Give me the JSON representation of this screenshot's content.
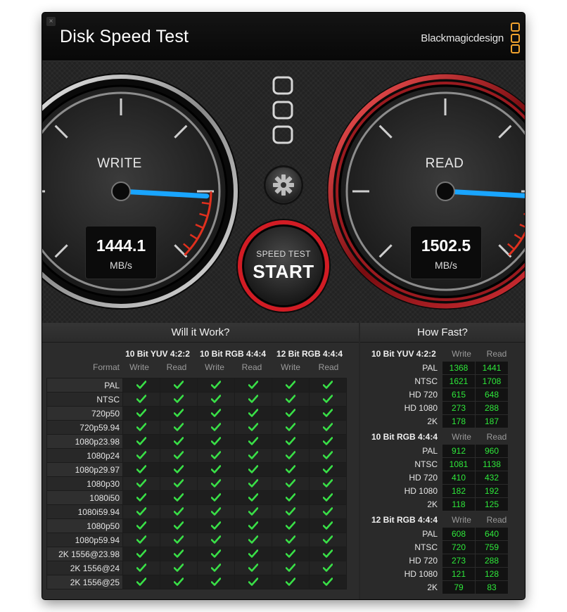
{
  "window": {
    "title": "Disk Speed Test",
    "brand": "Blackmagicdesign",
    "close_label": "×"
  },
  "gauges": {
    "write": {
      "label": "WRITE",
      "value": "1444.1",
      "unit": "MB/s",
      "needle_fraction": 0.845
    },
    "read": {
      "label": "READ",
      "value": "1502.5",
      "unit": "MB/s",
      "needle_fraction": 0.845
    }
  },
  "icons": {
    "settings": "gear-icon",
    "logo": "blackmagic-logo-icon",
    "check": "check-icon"
  },
  "start_button": {
    "small_label": "SPEED TEST",
    "big_label": "START"
  },
  "colors": {
    "accent_orange": "#f0a22e",
    "needle_blue": "#19a5ff",
    "ok_green": "#2ee83a",
    "read_ring_red": "#c0141c"
  },
  "will_it_work": {
    "title": "Will it Work?",
    "format_label": "Format",
    "write_label": "Write",
    "read_label": "Read",
    "groups": [
      "10 Bit YUV 4:2:2",
      "10 Bit RGB 4:4:4",
      "12 Bit RGB 4:4:4"
    ],
    "formats": [
      "PAL",
      "NTSC",
      "720p50",
      "720p59.94",
      "1080p23.98",
      "1080p24",
      "1080p29.97",
      "1080p30",
      "1080i50",
      "1080i59.94",
      "1080p50",
      "1080p59.94",
      "2K 1556@23.98",
      "2K 1556@24",
      "2K 1556@25"
    ]
  },
  "how_fast": {
    "title": "How Fast?",
    "write_label": "Write",
    "read_label": "Read",
    "groups": [
      {
        "name": "10 Bit YUV 4:2:2",
        "rows": [
          {
            "format": "PAL",
            "write": "1368",
            "read": "1441"
          },
          {
            "format": "NTSC",
            "write": "1621",
            "read": "1708"
          },
          {
            "format": "HD 720",
            "write": "615",
            "read": "648"
          },
          {
            "format": "HD 1080",
            "write": "273",
            "read": "288"
          },
          {
            "format": "2K",
            "write": "178",
            "read": "187"
          }
        ]
      },
      {
        "name": "10 Bit RGB 4:4:4",
        "rows": [
          {
            "format": "PAL",
            "write": "912",
            "read": "960"
          },
          {
            "format": "NTSC",
            "write": "1081",
            "read": "1138"
          },
          {
            "format": "HD 720",
            "write": "410",
            "read": "432"
          },
          {
            "format": "HD 1080",
            "write": "182",
            "read": "192"
          },
          {
            "format": "2K",
            "write": "118",
            "read": "125"
          }
        ]
      },
      {
        "name": "12 Bit RGB 4:4:4",
        "rows": [
          {
            "format": "PAL",
            "write": "608",
            "read": "640"
          },
          {
            "format": "NTSC",
            "write": "720",
            "read": "759"
          },
          {
            "format": "HD 720",
            "write": "273",
            "read": "288"
          },
          {
            "format": "HD 1080",
            "write": "121",
            "read": "128"
          },
          {
            "format": "2K",
            "write": "79",
            "read": "83"
          }
        ]
      }
    ]
  }
}
